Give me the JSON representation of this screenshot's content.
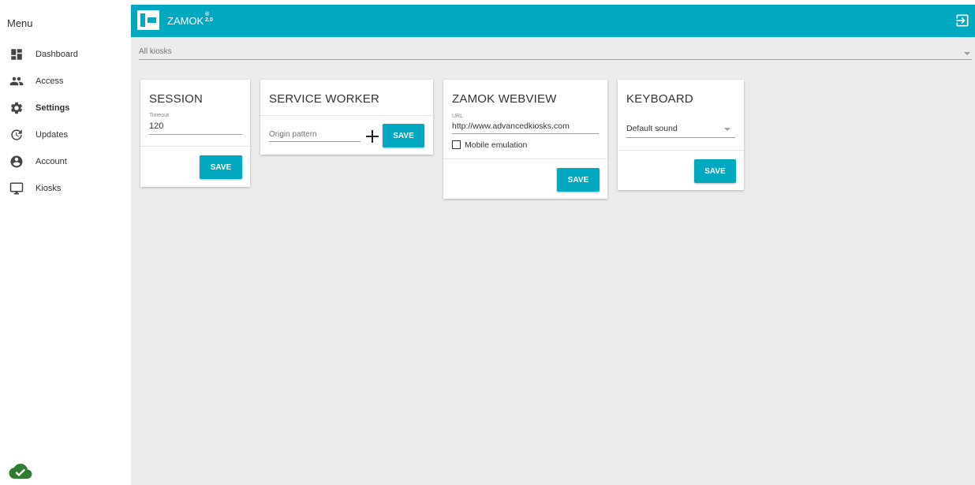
{
  "sidebar": {
    "title": "Menu",
    "items": [
      {
        "label": "Dashboard",
        "icon": "dashboard-icon"
      },
      {
        "label": "Access",
        "icon": "people-icon"
      },
      {
        "label": "Settings",
        "icon": "gear-icon",
        "active": true
      },
      {
        "label": "Updates",
        "icon": "update-icon"
      },
      {
        "label": "Account",
        "icon": "account-icon"
      },
      {
        "label": "Kiosks",
        "icon": "monitor-icon"
      }
    ],
    "status_icon": "cloud-check-icon"
  },
  "header": {
    "brand": "ZAMOK",
    "version_mark": "®",
    "version": "2.0",
    "logout_icon": "logout-icon",
    "color": "#00a8c0"
  },
  "kiosk_selector": {
    "value": "All kiosks"
  },
  "cards": {
    "session": {
      "title": "SESSION",
      "timeout_label": "Timeout",
      "timeout_value": "120",
      "save_label": "SAVE"
    },
    "service_worker": {
      "title": "SERVICE WORKER",
      "origin_placeholder": "Origin pattern",
      "save_label": "SAVE"
    },
    "webview": {
      "title": "ZAMOK WEBVIEW",
      "url_label": "URL",
      "url_value": "http://www.advancedkiosks.com",
      "mobile_label": "Mobile emulation",
      "mobile_checked": false,
      "save_label": "SAVE"
    },
    "keyboard": {
      "title": "KEYBOARD",
      "sound_value": "Default sound",
      "save_label": "SAVE"
    }
  }
}
